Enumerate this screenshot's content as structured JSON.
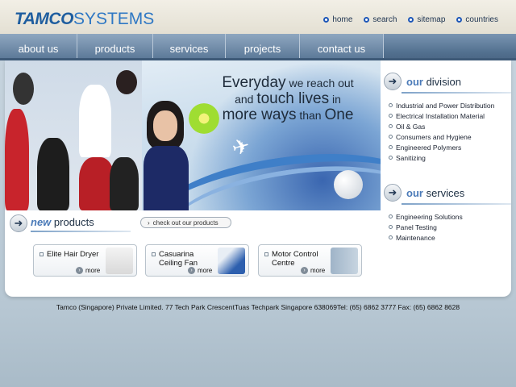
{
  "brand": {
    "logo_main": "TAMCO",
    "logo_sub": "SYSTEMS"
  },
  "top_links": [
    {
      "label": "home"
    },
    {
      "label": "search"
    },
    {
      "label": "sitemap"
    },
    {
      "label": "countries"
    }
  ],
  "nav": [
    {
      "label": "about us"
    },
    {
      "label": "products"
    },
    {
      "label": "services"
    },
    {
      "label": "projects"
    },
    {
      "label": "contact us"
    }
  ],
  "hero": {
    "line1_a": "Everyday",
    "line1_b": " we reach out",
    "line2_a": "and ",
    "line2_b": "touch lives",
    "line2_c": " in",
    "line3_a": "more ways",
    "line3_b": " than ",
    "line3_c": "One"
  },
  "division": {
    "title_a": "our",
    "title_b": " division",
    "items": [
      "Industrial and Power Distribution",
      "Electrical Installation Material",
      "Oil & Gas",
      "Consumers and Hygiene",
      "Engineered Polymers",
      "Sanitizing"
    ]
  },
  "services": {
    "title_a": "our",
    "title_b": " services",
    "items": [
      "Engineering Solutions",
      "Panel Testing",
      "Maintenance"
    ]
  },
  "new_products": {
    "title_a": "new",
    "title_b": " products",
    "checkout_label": "check out our products",
    "cards": [
      {
        "title": "Elite Hair Dryer",
        "more": "more"
      },
      {
        "title": "Casuarina Ceiling Fan",
        "more": "more"
      },
      {
        "title": "Motor Control Centre",
        "more": "more"
      }
    ]
  },
  "footer": {
    "text": "Tamco (Singapore) Private Limited. 77 Tech Park CrescentTuas Techpark Singapore 638069Tel: (65) 6862 3777 Fax: (65) 6862 8628"
  },
  "colors": {
    "accent": "#4a7ab8",
    "nav": "#5d7a99",
    "logo": "#1f5e9f"
  }
}
